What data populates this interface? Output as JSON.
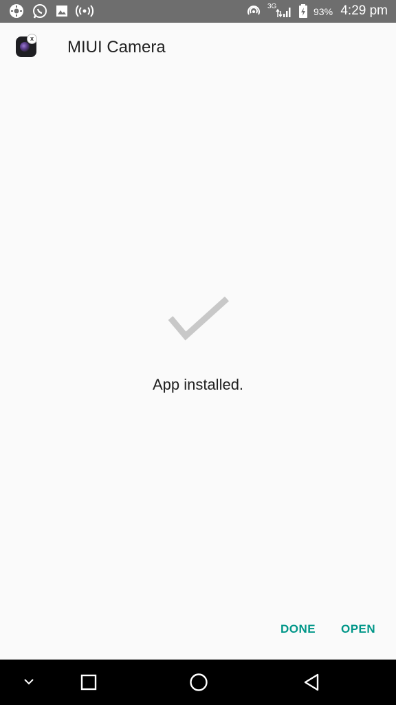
{
  "status_bar": {
    "battery_percent": "93%",
    "network_type": "3G",
    "time": "4:29 pm",
    "icons": [
      "settings-icon",
      "whatsapp-icon",
      "gallery-icon",
      "hotspot-icon",
      "nfc-icon",
      "signal-icon",
      "battery-charging-icon"
    ]
  },
  "app": {
    "icon": "miui-camera-app-icon",
    "name": "MIUI Camera"
  },
  "install": {
    "icon": "checkmark-icon",
    "message": "App installed."
  },
  "actions": {
    "done_label": "DONE",
    "open_label": "OPEN",
    "accent_color": "#009688"
  },
  "nav_bar": {
    "icons": [
      "collapse-icon",
      "recents-icon",
      "home-icon",
      "back-icon"
    ]
  }
}
